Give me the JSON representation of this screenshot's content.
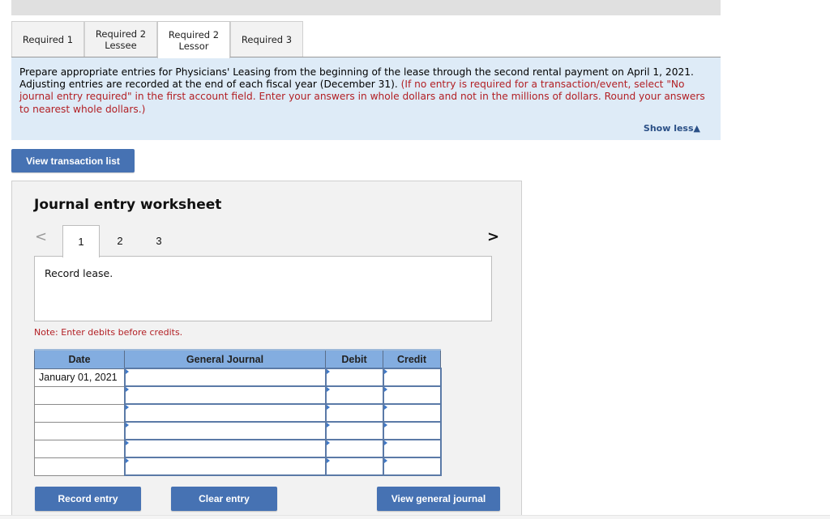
{
  "tabs": [
    {
      "line1": "Required 1",
      "line2": "",
      "active": false
    },
    {
      "line1": "Required 2",
      "line2": "Lessee",
      "active": false
    },
    {
      "line1": "Required 2",
      "line2": "Lessor",
      "active": true
    },
    {
      "line1": "Required 3",
      "line2": "",
      "active": false
    }
  ],
  "instructions": {
    "text_black": "Prepare appropriate entries for Physicians' Leasing from the beginning of the lease through the second rental payment on April 1, 2021. Adjusting entries are recorded at the end of each fiscal year (December 31).",
    "text_red": "(If no entry is required for a transaction/event, select \"No journal entry required\" in the first account field. Enter your answers in whole dollars and not in the millions of dollars. Round your answers to nearest whole dollars.)",
    "show_less_label": "Show less",
    "show_less_icon": "triangle-up-icon"
  },
  "view_transaction_list_label": "View transaction list",
  "worksheet": {
    "title": "Journal entry worksheet",
    "prev_icon": "chevron-left-icon",
    "next_icon": "chevron-right-icon",
    "steps": [
      "1",
      "2",
      "3"
    ],
    "active_step": "1",
    "description": "Record lease.",
    "note": "Note: Enter debits before credits.",
    "columns": [
      "Date",
      "General Journal",
      "Debit",
      "Credit"
    ],
    "rows": [
      {
        "date": "January 01, 2021",
        "account": "",
        "debit": "",
        "credit": ""
      },
      {
        "date": "",
        "account": "",
        "debit": "",
        "credit": ""
      },
      {
        "date": "",
        "account": "",
        "debit": "",
        "credit": ""
      },
      {
        "date": "",
        "account": "",
        "debit": "",
        "credit": ""
      },
      {
        "date": "",
        "account": "",
        "debit": "",
        "credit": ""
      },
      {
        "date": "",
        "account": "",
        "debit": "",
        "credit": ""
      }
    ],
    "buttons": {
      "record": "Record entry",
      "clear": "Clear entry",
      "view_general_journal": "View general journal"
    }
  },
  "colors": {
    "button_blue": "#4672b3",
    "instruction_bg": "#deebf7",
    "instruction_red": "#b21f24",
    "table_header_blue": "#83ade0"
  }
}
